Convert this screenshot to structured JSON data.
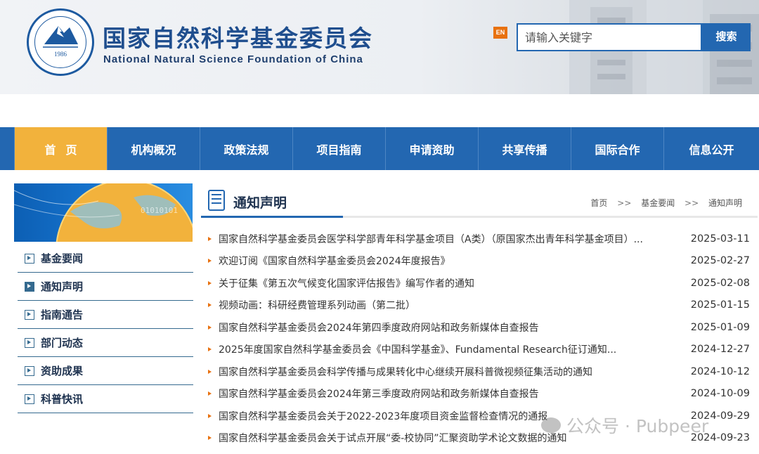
{
  "header": {
    "seal_year": "1986",
    "title": "国家自然科学基金委员会",
    "subtitle": "National Natural Science Foundation of China",
    "lang_badge": "EN",
    "search": {
      "placeholder": "请输入关键字",
      "button_label": "搜索"
    }
  },
  "nav": {
    "items": [
      {
        "label": "首页",
        "active": true
      },
      {
        "label": "机构概况"
      },
      {
        "label": "政策法规"
      },
      {
        "label": "项目指南"
      },
      {
        "label": "申请资助"
      },
      {
        "label": "共享传播"
      },
      {
        "label": "国际合作"
      },
      {
        "label": "信息公开"
      }
    ]
  },
  "sidebar": {
    "items": [
      {
        "label": "基金要闻"
      },
      {
        "label": "通知声明",
        "active": true
      },
      {
        "label": "指南通告"
      },
      {
        "label": "部门动态"
      },
      {
        "label": "资助成果"
      },
      {
        "label": "科普快讯"
      }
    ]
  },
  "content": {
    "section_title": "通知声明",
    "breadcrumb": [
      "首页",
      "基金要闻",
      "通知声明"
    ],
    "breadcrumb_sep": ">>",
    "news": [
      {
        "title": "国家自然科学基金委员会医学科学部青年科学基金项目（A类）（原国家杰出青年科学基金项目）...",
        "date": "2025-03-11"
      },
      {
        "title": "欢迎订阅《国家自然科学基金委员会2024年度报告》",
        "date": "2025-02-27"
      },
      {
        "title": "关于征集《第五次气候变化国家评估报告》编写作者的通知",
        "date": "2025-02-08"
      },
      {
        "title": "视频动画：科研经费管理系列动画（第二批）",
        "date": "2025-01-15"
      },
      {
        "title": "国家自然科学基金委员会2024年第四季度政府网站和政务新媒体自查报告",
        "date": "2025-01-09"
      },
      {
        "title": "2025年度国家自然科学基金委员会《中国科学基金》、Fundamental Research征订通知...",
        "date": "2024-12-27"
      },
      {
        "title": "国家自然科学基金委员会科学传播与成果转化中心继续开展科普微视频征集活动的通知",
        "date": "2024-10-12"
      },
      {
        "title": "国家自然科学基金委员会2024年第三季度政府网站和政务新媒体自查报告",
        "date": "2024-10-09"
      },
      {
        "title": "国家自然科学基金委员会关于2022-2023年度项目资金监督检查情况的通报",
        "date": "2024-09-29"
      },
      {
        "title": "国家自然科学基金委员会关于试点开展“委-校协同”汇聚资助学术论文数据的通知",
        "date": "2024-09-23"
      }
    ]
  },
  "watermark": {
    "text": "公众号 · Pubpeer"
  },
  "colors": {
    "primary": "#2367b1",
    "accent": "#f2b23c",
    "bullet": "#e8710f",
    "sidebar_line": "#356a8f"
  }
}
